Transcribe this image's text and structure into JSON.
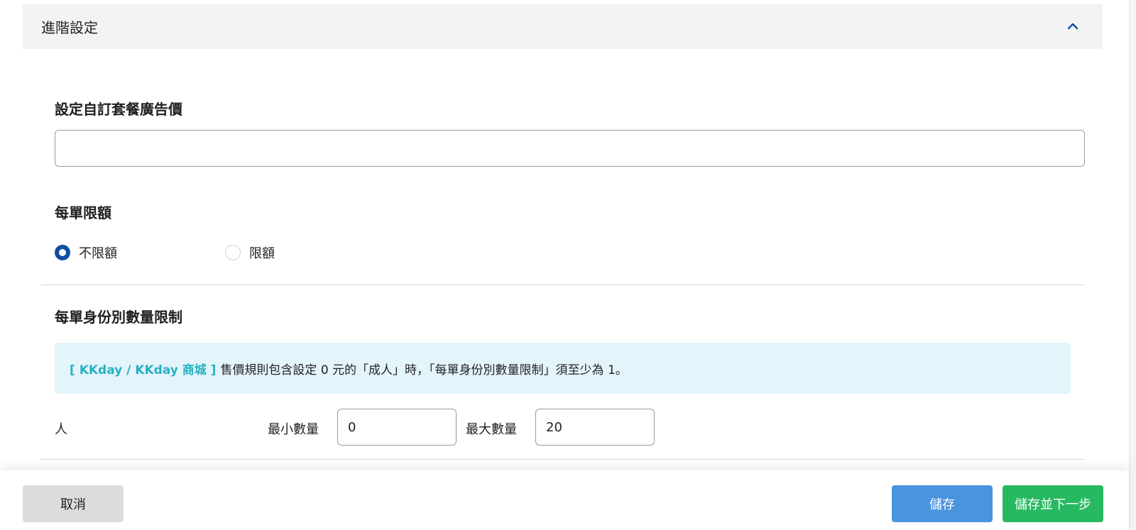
{
  "section": {
    "title": "進階設定"
  },
  "ad_price": {
    "label": "設定自訂套餐廣告價",
    "value": "",
    "placeholder": ""
  },
  "order_limit": {
    "label": "每單限額",
    "options": [
      {
        "label": "不限額",
        "selected": true
      },
      {
        "label": "限額",
        "selected": false
      }
    ]
  },
  "identity_limit": {
    "label": "每單身份別數量限制",
    "notice_tag": "[ KKday / KKday 商城 ]",
    "notice_text": "售價規則包含設定 0 元的「成人」時，「每單身份別數量限制」須至少為 1。",
    "rows": [
      {
        "identity": "人",
        "min_label": "最小數量",
        "min_value": "0",
        "max_label": "最大數量",
        "max_value": "20"
      }
    ]
  },
  "footer": {
    "cancel": "取消",
    "save": "儲存",
    "save_next": "儲存並下一步"
  },
  "colors": {
    "primary_radio": "#0f4ea3",
    "save": "#4a93df",
    "save_next": "#27b962",
    "notice_bg": "#e4f4fb",
    "notice_tag": "#26b1c3"
  },
  "icons": {
    "section_toggle": "chevron-up-icon"
  }
}
